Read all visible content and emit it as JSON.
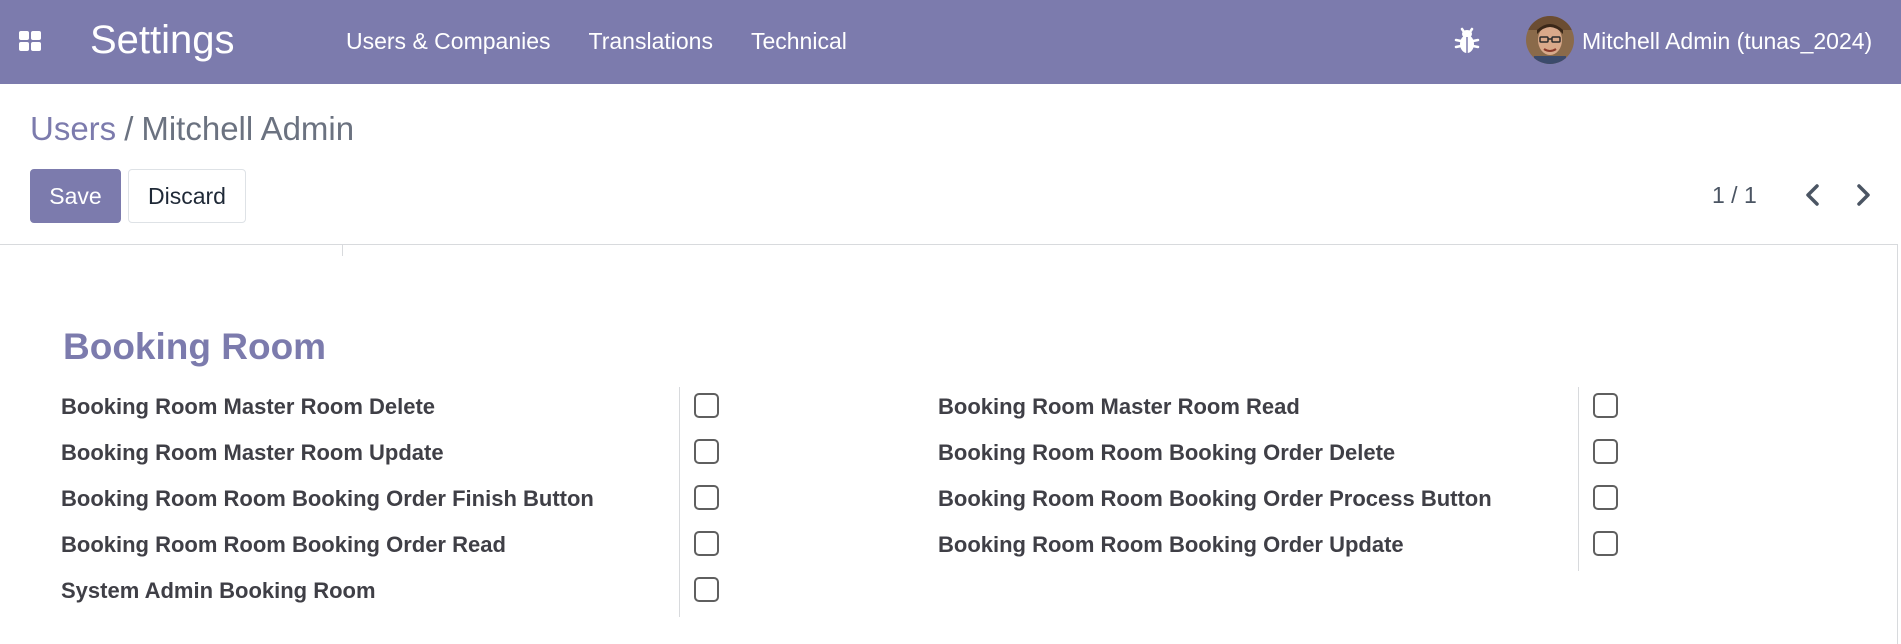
{
  "navbar": {
    "app_title": "Settings",
    "menu": [
      "Users & Companies",
      "Translations",
      "Technical"
    ],
    "user_name": "Mitchell Admin (tunas_2024)",
    "icons": [
      "apps-grid-icon",
      "bug-icon"
    ],
    "bg_color": "#7c7bad"
  },
  "breadcrumb": {
    "parent": "Users",
    "separator": "/",
    "current": "Mitchell Admin"
  },
  "actions": {
    "save_label": "Save",
    "discard_label": "Discard"
  },
  "pager": {
    "value": "1 / 1"
  },
  "section": {
    "title": "Booking Room",
    "left_fields": [
      {
        "label": "Booking Room Master Room Delete",
        "checked": false
      },
      {
        "label": "Booking Room Master Room Update",
        "checked": false
      },
      {
        "label": "Booking Room Room Booking Order Finish Button",
        "checked": false
      },
      {
        "label": "Booking Room Room Booking Order Read",
        "checked": false
      },
      {
        "label": "System Admin Booking Room",
        "checked": false
      }
    ],
    "right_fields": [
      {
        "label": "Booking Room Master Room Read",
        "checked": false
      },
      {
        "label": "Booking Room Room Booking Order Delete",
        "checked": false
      },
      {
        "label": "Booking Room Room Booking Order Process Button",
        "checked": false
      },
      {
        "label": "Booking Room Room Booking Order Update",
        "checked": false
      }
    ]
  }
}
